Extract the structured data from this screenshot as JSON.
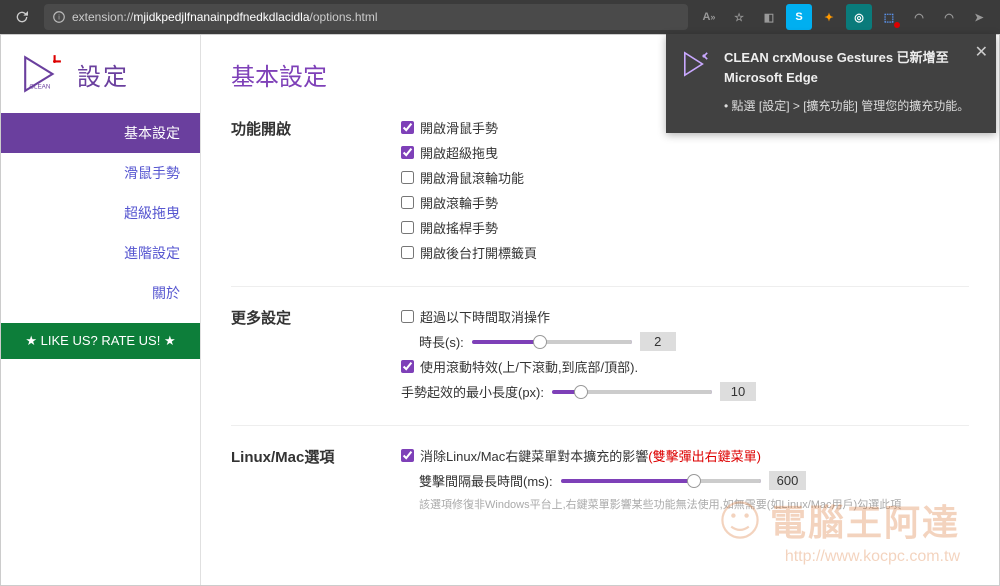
{
  "browser": {
    "url_prefix": "extension://",
    "url_id": "mjidkpedjlfnanainpdfnedkdlacidla",
    "url_path": "/options.html"
  },
  "notification": {
    "title": "CLEAN crxMouse Gestures 已新增至 Microsoft Edge",
    "hint1": "• 點選 [設定] > [擴充功能] 管理您的擴充功能。"
  },
  "sidebar": {
    "logo_text": "設定",
    "items": [
      {
        "label": "基本設定"
      },
      {
        "label": "滑鼠手勢"
      },
      {
        "label": "超級拖曳"
      },
      {
        "label": "進階設定"
      },
      {
        "label": "關於"
      }
    ],
    "rate": "★ LIKE US? RATE US! ★"
  },
  "content": {
    "title": "基本設定",
    "sections": {
      "features": {
        "label": "功能開啟",
        "checks": [
          {
            "label": "開啟滑鼠手勢",
            "checked": true
          },
          {
            "label": "開啟超級拖曳",
            "checked": true
          },
          {
            "label": "開啟滑鼠滾輪功能",
            "checked": false
          },
          {
            "label": "開啟滾輪手勢",
            "checked": false
          },
          {
            "label": "開啟搖桿手勢",
            "checked": false
          },
          {
            "label": "開啟後台打開標籤頁",
            "checked": false
          }
        ]
      },
      "more": {
        "label": "更多設定",
        "timeout_check": "超過以下時間取消操作",
        "timeout_checked": false,
        "duration_label": "時長(s):",
        "duration_value": "2",
        "scrollfx_check": "使用滾動特效(上/下滾動,到底部/頂部).",
        "scrollfx_checked": true,
        "minlen_label": "手勢起效的最小長度(px):",
        "minlen_value": "10"
      },
      "linux": {
        "label": "Linux/Mac選項",
        "fix_check": "消除Linux/Mac右鍵菜單對本擴充的影響",
        "fix_checked": true,
        "fix_hint": "(雙擊彈出右鍵菜單)",
        "dbl_label": "雙擊間隔最長時間(ms):",
        "dbl_value": "600",
        "help": "該選項修復非Windows平台上,右鍵菜單影響某些功能無法使用,如無需要(如Linux/Mac用戶)勾選此項"
      }
    }
  },
  "watermark": {
    "text": "電腦王阿達",
    "url": "http://www.kocpc.com.tw"
  }
}
